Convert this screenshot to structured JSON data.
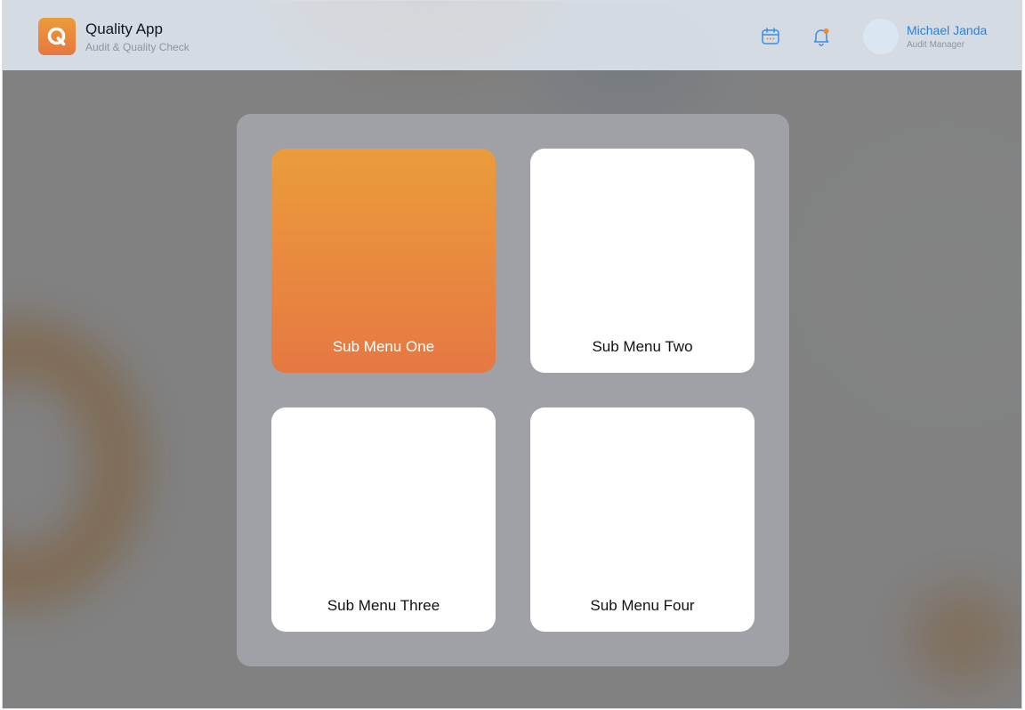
{
  "app": {
    "logo_letter": "Q",
    "title": "Quality App",
    "subtitle": "Audit & Quality Check"
  },
  "header": {
    "icons": [
      "calendar-icon",
      "bell-icon"
    ],
    "notification_dot_color": "#f08a2c",
    "user": {
      "name": "Michael Janda",
      "role": "Audit Manager"
    }
  },
  "menu": {
    "items": [
      {
        "label": "Sub Menu One",
        "active": true
      },
      {
        "label": "Sub Menu Two",
        "active": false
      },
      {
        "label": "Sub Menu Three",
        "active": false
      },
      {
        "label": "Sub Menu Four",
        "active": false
      }
    ]
  },
  "colors": {
    "accent_start": "#eb9c3b",
    "accent_end": "#e67843",
    "user_name": "#2f7fd6",
    "icon_blue": "#3a8ee6"
  }
}
